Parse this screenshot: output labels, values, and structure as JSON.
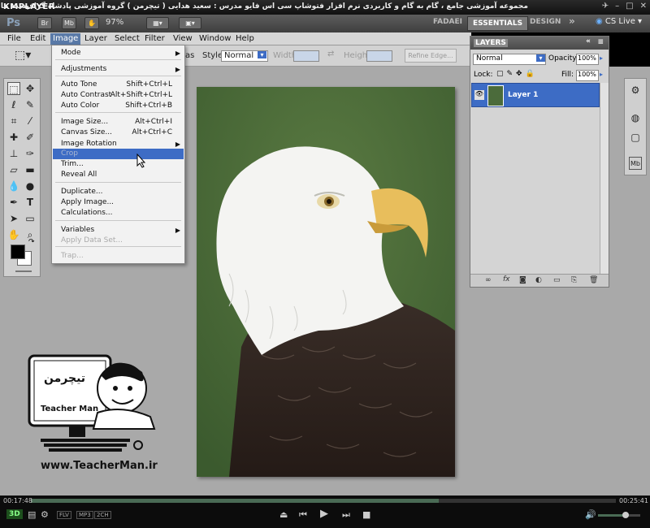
{
  "kmplayer": {
    "logo": "KMPLAYER",
    "title": "مجموعه آموزشی جامع ، گام به گام و کاربردی نرم افزار فتوشاپ سی اس فایو   مدرس : سعید هدایی ( تیچرمن ) گروه آموزشی پادشاه گرافیست ها"
  },
  "ps": {
    "logo": "Ps",
    "br": "Br",
    "mb": "Mb",
    "zoom": "97%",
    "workspaces": [
      "FADAEI",
      "ESSENTIALS",
      "DESIGN"
    ],
    "more": "»",
    "cs_live": "CS Live"
  },
  "menubar": [
    "File",
    "Edit",
    "Image",
    "Layer",
    "Select",
    "Filter",
    "View",
    "Window",
    "Help"
  ],
  "options": {
    "style_label": "Style:",
    "style_value": "Normal",
    "width_label": "Width:",
    "height_label": "Height:",
    "refine_edge": "Refine Edge..."
  },
  "image_menu": {
    "items": [
      {
        "label": "Mode",
        "shortcut": "",
        "submenu": true,
        "disabled": false
      },
      {
        "label": "Adjustments",
        "shortcut": "",
        "submenu": true,
        "disabled": false
      },
      {
        "label": "Auto Tone",
        "shortcut": "Shift+Ctrl+L",
        "submenu": false,
        "disabled": false
      },
      {
        "label": "Auto Contrast",
        "shortcut": "Alt+Shift+Ctrl+L",
        "submenu": false,
        "disabled": false
      },
      {
        "label": "Auto Color",
        "shortcut": "Shift+Ctrl+B",
        "submenu": false,
        "disabled": false
      },
      {
        "label": "Image Size...",
        "shortcut": "Alt+Ctrl+I",
        "submenu": false,
        "disabled": false
      },
      {
        "label": "Canvas Size...",
        "shortcut": "Alt+Ctrl+C",
        "submenu": false,
        "disabled": false
      },
      {
        "label": "Image Rotation",
        "shortcut": "",
        "submenu": true,
        "disabled": false
      },
      {
        "label": "Crop",
        "shortcut": "",
        "submenu": false,
        "disabled": true
      },
      {
        "label": "Trim...",
        "shortcut": "",
        "submenu": false,
        "disabled": false
      },
      {
        "label": "Reveal All",
        "shortcut": "",
        "submenu": false,
        "disabled": false
      },
      {
        "label": "Duplicate...",
        "shortcut": "",
        "submenu": false,
        "disabled": false
      },
      {
        "label": "Apply Image...",
        "shortcut": "",
        "submenu": false,
        "disabled": false
      },
      {
        "label": "Calculations...",
        "shortcut": "",
        "submenu": false,
        "disabled": false
      },
      {
        "label": "Variables",
        "shortcut": "",
        "submenu": true,
        "disabled": false
      },
      {
        "label": "Apply Data Set...",
        "shortcut": "",
        "submenu": false,
        "disabled": true
      },
      {
        "label": "Trap...",
        "shortcut": "",
        "submenu": false,
        "disabled": true
      }
    ],
    "highlighted": "Crop"
  },
  "layers": {
    "title": "LAYERS",
    "blend": "Normal",
    "opacity_label": "Opacity:",
    "opacity": "100%",
    "lock_label": "Lock:",
    "fill_label": "Fill:",
    "fill": "100%",
    "layer_name": "Layer 1"
  },
  "logo": {
    "name_fa": "تیچرمن",
    "caption": "Teacher Man",
    "site": "www.TeacherMan.ir"
  },
  "player": {
    "elapsed": "00:17:48",
    "total": "00:25:41",
    "progress": 0.697,
    "badges": [
      "FLV",
      "MP3",
      "2CH"
    ],
    "three_d": "3D"
  }
}
